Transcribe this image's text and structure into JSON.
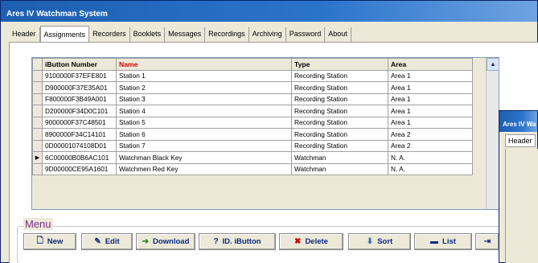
{
  "window": {
    "title": "Ares IV Watchman System"
  },
  "tabs": [
    "Header",
    "Assignments",
    "Recorders",
    "Booklets",
    "Messages",
    "Recordings",
    "Archiving",
    "Password",
    "About"
  ],
  "active_tab": "Assignments",
  "grid": {
    "columns": [
      "iButton Number",
      "Name",
      "Type",
      "Area"
    ],
    "rows": [
      [
        "9100000F37EFE801",
        "Station 1",
        "Recording Station",
        "Area 1"
      ],
      [
        "D900000F37E35A01",
        "Station 2",
        "Recording Station",
        "Area 1"
      ],
      [
        "F800000F3B49A001",
        "Station 3",
        "Recording Station",
        "Area 1"
      ],
      [
        "D200000F34D0C101",
        "Station 4",
        "Recording Station",
        "Area 1"
      ],
      [
        "9000000F37C48501",
        "Station 5",
        "Recording Station",
        "Area 1"
      ],
      [
        "8900000F34C14101",
        "Station 6",
        "Recording Station",
        "Area 2"
      ],
      [
        "0D00001074108D01",
        "Station 7",
        "Recording Station",
        "Area 2"
      ],
      [
        "6C00000B0B6AC101",
        "Watchman Black Key",
        "Watchman",
        "N. A."
      ],
      [
        "9D00000CE95A1601",
        "Watchmen Red Key",
        "Watchman",
        "N. A."
      ]
    ],
    "current_row_marker": "▶",
    "current_row_index": 7
  },
  "menu": {
    "title": "Menu",
    "buttons": {
      "new": "New",
      "edit": "Edit",
      "download": "Download",
      "id_ibutton": "ID. iButton",
      "delete": "Delete",
      "sort": "Sort",
      "list": "List"
    }
  },
  "second_window": {
    "title": "Ares IV Wa",
    "tab": "Header"
  }
}
